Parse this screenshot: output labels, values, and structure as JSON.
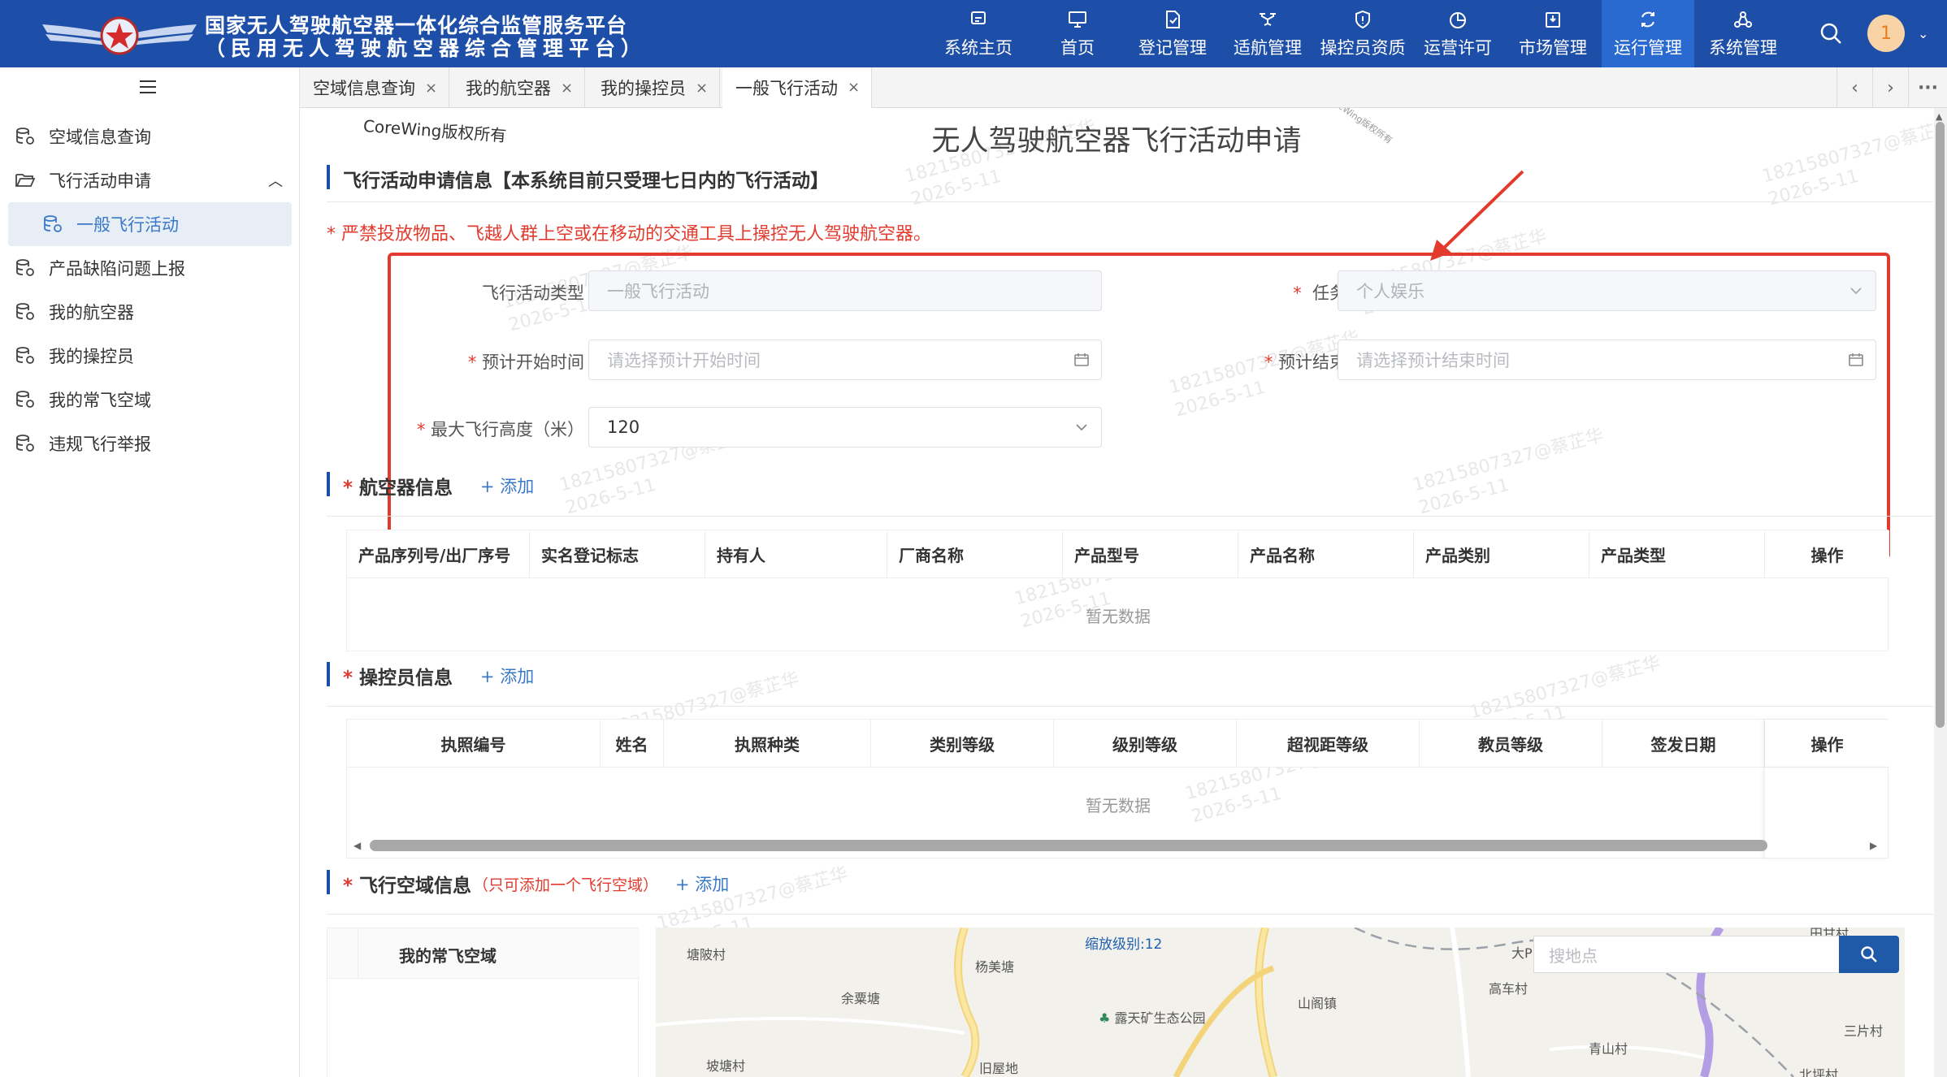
{
  "header": {
    "title_line1": "国家无人驾驶航空器一体化综合监管服务平台",
    "title_line2": "（民用无人驾驶航空器综合管理平台）",
    "nav": [
      {
        "label": "系统主页",
        "icon": "home-page-icon"
      },
      {
        "label": "首页",
        "icon": "monitor-icon"
      },
      {
        "label": "登记管理",
        "icon": "register-doc-icon"
      },
      {
        "label": "适航管理",
        "icon": "drone-icon"
      },
      {
        "label": "操控员资质",
        "icon": "shield-icon"
      },
      {
        "label": "运营许可",
        "icon": "pie-chart-icon"
      },
      {
        "label": "市场管理",
        "icon": "market-icon"
      },
      {
        "label": "运行管理",
        "icon": "cycle-icon"
      },
      {
        "label": "系统管理",
        "icon": "system-icon"
      }
    ],
    "active_nav": "运行管理",
    "avatar_text": "1"
  },
  "sidebar": {
    "items": [
      {
        "label": "空域信息查询",
        "icon": "database-icon"
      },
      {
        "label": "飞行活动申请",
        "icon": "folder-open-icon",
        "expanded": true
      },
      {
        "label": "一般飞行活动",
        "icon": "database-icon",
        "active": true
      },
      {
        "label": "产品缺陷问题上报",
        "icon": "database-icon"
      },
      {
        "label": "我的航空器",
        "icon": "database-icon"
      },
      {
        "label": "我的操控员",
        "icon": "database-icon"
      },
      {
        "label": "我的常飞空域",
        "icon": "database-icon"
      },
      {
        "label": "违规飞行举报",
        "icon": "database-icon"
      }
    ]
  },
  "tabs": [
    {
      "label": "空域信息查询",
      "active": false
    },
    {
      "label": "我的航空器",
      "active": false
    },
    {
      "label": "我的操控员",
      "active": false
    },
    {
      "label": "一般飞行活动",
      "active": true
    }
  ],
  "page": {
    "copyright": "CoreWing版权所有",
    "copyright_small": "CoreWing版权所有",
    "title": "无人驾驶航空器飞行活动申请",
    "watermark_line1": "18215807327@蔡芷华",
    "watermark_line2": "2026-5-11"
  },
  "form_section": {
    "title": "飞行活动申请信息【本系统目前只受理七日内的飞行活动】",
    "warning": "* 严禁投放物品、飞越人群上空或在移动的交通工具上操控无人驾驶航空器。",
    "fields": {
      "activity_type": {
        "label": "飞行活动类型",
        "value": "一般飞行活动"
      },
      "task_nature": {
        "label": "任务性质",
        "value": "个人娱乐"
      },
      "start_time": {
        "label": "预计开始时间",
        "placeholder": "请选择预计开始时间"
      },
      "end_time": {
        "label": "预计结束时间",
        "placeholder": "请选择预计结束时间"
      },
      "max_height": {
        "label": "最大飞行高度（米）",
        "value": "120"
      }
    }
  },
  "aircraft_section": {
    "title": "航空器信息",
    "add_label": "+ 添加",
    "columns": [
      "产品序列号/出厂序号",
      "实名登记标志",
      "持有人",
      "厂商名称",
      "产品型号",
      "产品名称",
      "产品类别",
      "产品类型",
      "操作"
    ],
    "empty_text": "暂无数据"
  },
  "operator_section": {
    "title": "操控员信息",
    "add_label": "+ 添加",
    "columns": [
      "执照编号",
      "姓名",
      "执照种类",
      "类别等级",
      "级别等级",
      "超视距等级",
      "教员等级",
      "签发日期",
      "操作"
    ],
    "empty_text": "暂无数据"
  },
  "airspace_section": {
    "title": "飞行空域信息",
    "note": "（只可添加一个飞行空域）",
    "add_label": "+ 添加",
    "list_header": "我的常飞空域"
  },
  "map": {
    "zoom_label": "缩放级别:12",
    "search_placeholder": "搜地点",
    "places": [
      "塘陂村",
      "杨美塘",
      "余粟塘",
      "露天矿生态公园",
      "山阁镇",
      "高车村",
      "大P",
      "青山村",
      "三片村",
      "坡塘村",
      "旧屋地",
      "北坪村",
      "田甘村"
    ]
  },
  "colors": {
    "header_bg": "#1e4fa8",
    "active_nav_bg": "#2a6ad0",
    "required_red": "#e23b2e",
    "link_blue": "#3a78c8",
    "annotation_red": "#e23b2e"
  }
}
